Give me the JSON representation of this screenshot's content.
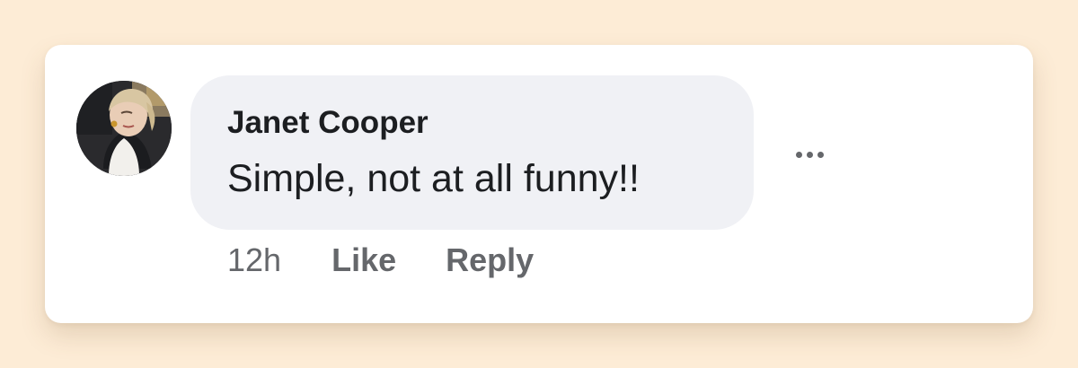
{
  "comment": {
    "author": "Janet Cooper",
    "text": "Simple, not at all funny!!",
    "timestamp": "12h",
    "like_label": "Like",
    "reply_label": "Reply",
    "more_icon": "ellipsis-horizontal-icon",
    "avatar_icon": "profile-photo"
  },
  "colors": {
    "page_background": "#fdecd6",
    "card_background": "#ffffff",
    "bubble_background": "#f0f1f5",
    "primary_text": "#1c1e21",
    "secondary_text": "#65676b"
  }
}
